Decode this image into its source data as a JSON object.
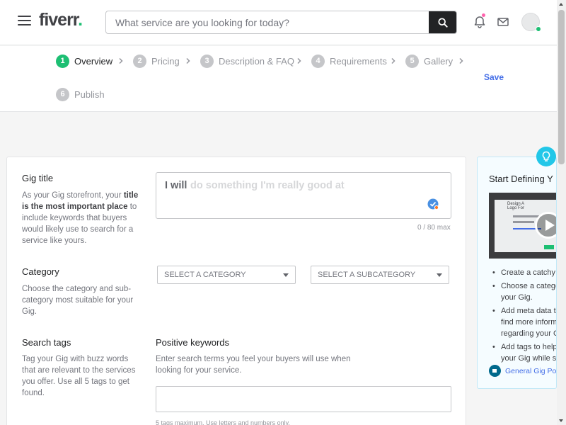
{
  "header": {
    "logo_text": "fiverr",
    "logo_dot": ".",
    "search_placeholder": "What service are you looking for today?",
    "icons": [
      "menu-icon",
      "search-icon",
      "bell-icon",
      "mail-icon",
      "avatar"
    ],
    "accent_color": "#1dbf73",
    "notification_color": "#ff62ad"
  },
  "stepper": {
    "steps": [
      {
        "num": "1",
        "label": "Overview",
        "active": true
      },
      {
        "num": "2",
        "label": "Pricing",
        "active": false
      },
      {
        "num": "3",
        "label": "Description & FAQ",
        "active": false
      },
      {
        "num": "4",
        "label": "Requirements",
        "active": false
      },
      {
        "num": "5",
        "label": "Gallery",
        "active": false
      },
      {
        "num": "6",
        "label": "Publish",
        "active": false
      }
    ],
    "save_label": "Save"
  },
  "form": {
    "gig_title": {
      "label": "Gig title",
      "desc_part1": "As your Gig storefront, your ",
      "desc_bold": "title is the most important place",
      "desc_part2": " to include keywords that buyers would likely use to search for a service like yours.",
      "prefix": "I will",
      "placeholder": "do something I'm really good at",
      "counter": "0 / 80 max"
    },
    "category": {
      "label": "Category",
      "desc": "Choose the category and sub-category most suitable for your Gig.",
      "category_select": "SELECT A CATEGORY",
      "subcategory_select": "SELECT A SUBCATEGORY"
    },
    "search_tags": {
      "label": "Search tags",
      "desc": "Tag your Gig with buzz words that are relevant to the services you offer. Use all 5 tags to get found.",
      "positive_label": "Positive keywords",
      "positive_desc": "Enter search terms you feel your buyers will use when looking for your service.",
      "hint": "5 tags maximum. Use letters and numbers only."
    }
  },
  "tips": {
    "title": "Start Defining Y",
    "items": [
      [
        "Create a catchy"
      ],
      [
        "Choose a catego",
        "your Gig."
      ],
      [
        "Add meta data t",
        "find more inform",
        "regarding your G"
      ],
      [
        "Add tags to help",
        "your Gig while se"
      ]
    ],
    "video_title_1": "Design A",
    "video_title_2": "Logo For",
    "policy_link": "General Gig Poli",
    "panel_border_color": "#c2e8f7",
    "bulb_color": "#22c7e8"
  }
}
